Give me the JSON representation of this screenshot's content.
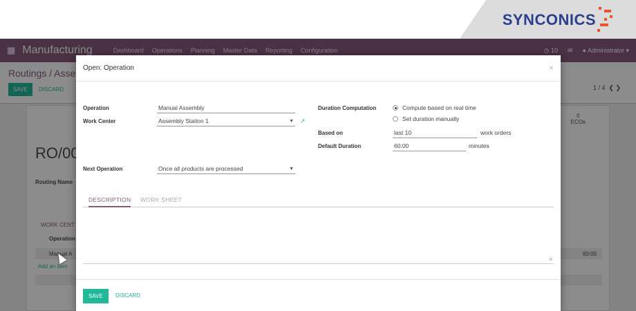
{
  "brand": {
    "name": "SYNCONICS"
  },
  "app": {
    "title": "Manufacturing",
    "menu": [
      "Dashboard",
      "Operations",
      "Planning",
      "Master Data",
      "Reporting",
      "Configuration"
    ],
    "notifications": "10",
    "user": "Administrator",
    "breadcrumb": "Routings / Asse",
    "save_label": "SAVE",
    "discard_label": "DISCARD",
    "pager": "1 / 4",
    "record_ref": "RO/00",
    "routing_name_label": "Routing Name",
    "ecos_count": "0",
    "ecos_label": "ECOs",
    "work_center_tab": "WORK CENT",
    "operation_header": "Operation",
    "row_operation": "Manual A",
    "row_duration": "60:00",
    "add_item": "Add an item"
  },
  "modal": {
    "title": "Open: Operation",
    "close": "×",
    "operation_label": "Operation",
    "operation_value": "Manual Assembly",
    "work_center_label": "Work Center",
    "work_center_value": "Assembly Station 1",
    "next_operation_label": "Next Operation",
    "next_operation_value": "Once all products are processed",
    "duration_computation_label": "Duration Computation",
    "radio_real_time": "Compute based on real time",
    "radio_manual": "Set duration manually",
    "based_on_label": "Based on",
    "based_on_value": "last 10",
    "based_on_unit": "work orders",
    "default_duration_label": "Default Duration",
    "default_duration_value": "60:00",
    "default_duration_unit": "minutes",
    "tab_description": "DESCRIPTION",
    "tab_work_sheet": "WORK SHEET",
    "save_label": "SAVE",
    "discard_label": "DISCARD"
  },
  "colors": {
    "brand_purple": "#875a7b",
    "accent_green": "#21b799",
    "logo_blue": "#2c3e8f",
    "logo_orange": "#e8552a"
  }
}
